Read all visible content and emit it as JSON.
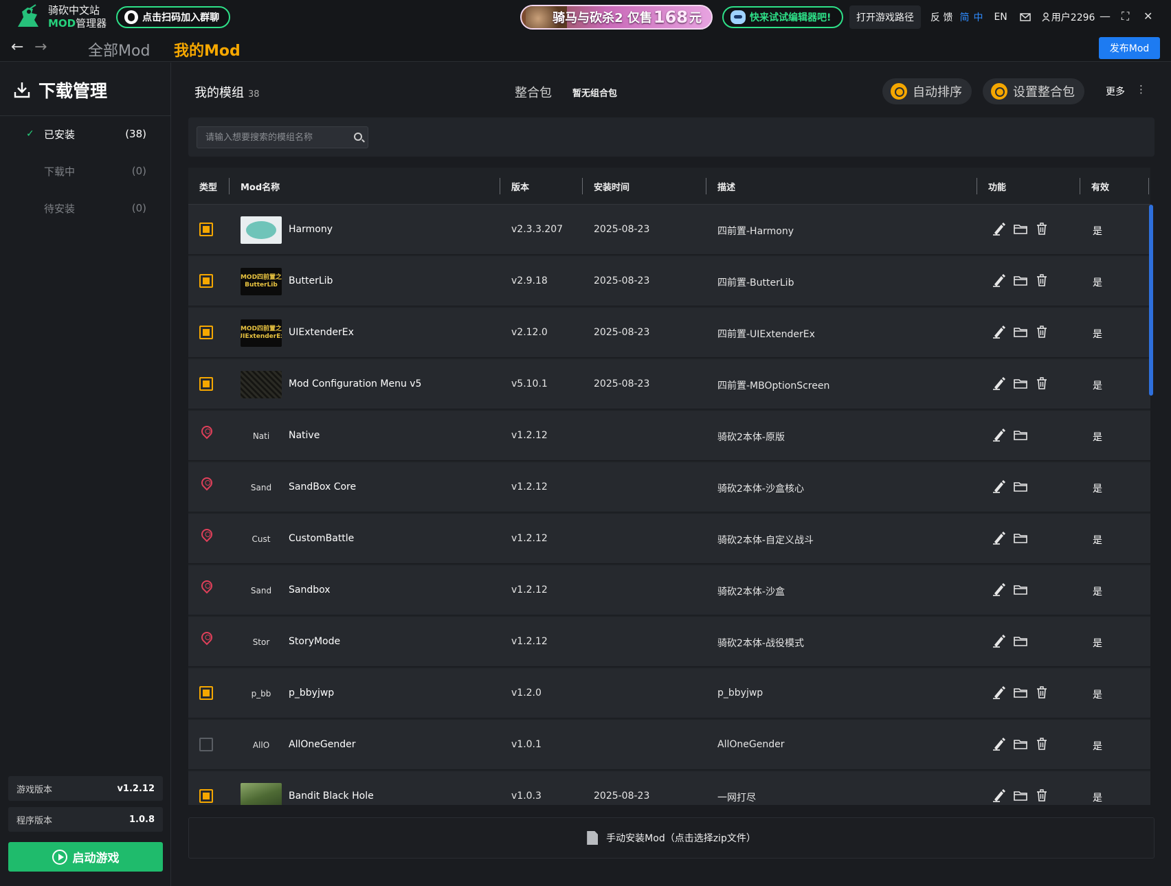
{
  "topbar": {
    "logo_line1": "骑砍中文站",
    "logo_mod": "MOD",
    "logo_line2_rest": "管理器",
    "group_button": "点击扫码加入群聊",
    "banner_text_pre": "骑马与砍杀2 仅售",
    "banner_price": "168",
    "banner_unit": "元",
    "edit_banner": "快来试试编辑器吧!",
    "open_path": "打开游戏路径",
    "feedback": "反 馈",
    "lang_cn_simplified": "简",
    "lang_cn": "中",
    "lang_en": "EN",
    "user": "用户2296",
    "window_controls": {
      "minimize": "—",
      "maximize": "⛶",
      "close": "✕"
    }
  },
  "nav": {
    "back": "←",
    "forward": "→",
    "tab_all": "全部Mod",
    "tab_mine": "我的Mod",
    "publish": "发布Mod"
  },
  "sidebar": {
    "title": "下载管理",
    "items": [
      {
        "label": "已安装",
        "count": "(38)",
        "active": true
      },
      {
        "label": "下载中",
        "count": "(0)",
        "active": false
      },
      {
        "label": "待安装",
        "count": "(0)",
        "active": false
      }
    ],
    "game_version_label": "游戏版本",
    "game_version": "v1.2.12",
    "app_version_label": "程序版本",
    "app_version": "1.0.8",
    "launch": "启动游戏"
  },
  "main": {
    "title": "我的模组",
    "count": "38",
    "pack_label": "整合包",
    "pack_none": "暂无组合包",
    "auto_sort": "自动排序",
    "set_pack": "设置整合包",
    "more": "更多",
    "more_dots": "⋮",
    "search_placeholder": "请输入想要搜索的模组名称",
    "columns": {
      "type": "类型",
      "name": "Mod名称",
      "version": "版本",
      "install_time": "安装时间",
      "description": "描述",
      "function": "功能",
      "valid": "有效"
    },
    "rows": [
      {
        "type": "checked",
        "thumb": "",
        "thumb_style": "harmony",
        "name": "Harmony",
        "version": "v2.3.3.207",
        "date": "2025-08-23",
        "desc": "四前置-Harmony",
        "delete": true,
        "valid": "是"
      },
      {
        "type": "checked",
        "thumb": "MOD四前置之\nButterLib",
        "thumb_style": "dark",
        "name": "ButterLib",
        "version": "v2.9.18",
        "date": "2025-08-23",
        "desc": "四前置-ButterLib",
        "delete": true,
        "valid": "是"
      },
      {
        "type": "checked",
        "thumb": "MOD四前置之\nUIExtenderEx",
        "thumb_style": "dark",
        "name": "UIExtenderEx",
        "version": "v2.12.0",
        "date": "2025-08-23",
        "desc": "四前置-UIExtenderEx",
        "delete": true,
        "valid": "是"
      },
      {
        "type": "checked",
        "thumb": "",
        "thumb_style": "texture",
        "name": "Mod Configuration Menu v5",
        "version": "v5.10.1",
        "date": "2025-08-23",
        "desc": "四前置-MBOptionScreen",
        "delete": true,
        "valid": "是"
      },
      {
        "type": "native",
        "thumb": "Nati",
        "thumb_style": "plain",
        "name": "Native",
        "version": "v1.2.12",
        "date": "",
        "desc": "骑砍2本体-原版",
        "delete": false,
        "valid": "是"
      },
      {
        "type": "native",
        "thumb": "Sand",
        "thumb_style": "plain",
        "name": "SandBox Core",
        "version": "v1.2.12",
        "date": "",
        "desc": "骑砍2本体-沙盒核心",
        "delete": false,
        "valid": "是"
      },
      {
        "type": "native",
        "thumb": "Cust",
        "thumb_style": "plain",
        "name": "CustomBattle",
        "version": "v1.2.12",
        "date": "",
        "desc": "骑砍2本体-自定义战斗",
        "delete": false,
        "valid": "是"
      },
      {
        "type": "native",
        "thumb": "Sand",
        "thumb_style": "plain",
        "name": "Sandbox",
        "version": "v1.2.12",
        "date": "",
        "desc": "骑砍2本体-沙盒",
        "delete": false,
        "valid": "是"
      },
      {
        "type": "native",
        "thumb": "Stor",
        "thumb_style": "plain",
        "name": "StoryMode",
        "version": "v1.2.12",
        "date": "",
        "desc": "骑砍2本体-战役模式",
        "delete": false,
        "valid": "是"
      },
      {
        "type": "checked",
        "thumb": "p_bb",
        "thumb_style": "plain",
        "name": "p_bbyjwp",
        "version": "v1.2.0",
        "date": "",
        "desc": "p_bbyjwp",
        "delete": true,
        "valid": "是"
      },
      {
        "type": "unchecked",
        "thumb": "AllO",
        "thumb_style": "plain",
        "name": "AllOneGender",
        "version": "v1.0.1",
        "date": "",
        "desc": "AllOneGender",
        "delete": true,
        "valid": "是"
      },
      {
        "type": "checked",
        "thumb": "",
        "thumb_style": "landscape",
        "name": "Bandit Black Hole",
        "version": "v1.0.3",
        "date": "2025-08-23",
        "desc": "一网打尽",
        "delete": true,
        "valid": "是"
      }
    ],
    "manual_install": "手动安装Mod（点击选择zip文件）"
  },
  "colors": {
    "accent_green": "#26d07c",
    "accent_orange": "#f5a700",
    "accent_blue": "#1d7bf2",
    "pin_red": "#e0405a"
  }
}
